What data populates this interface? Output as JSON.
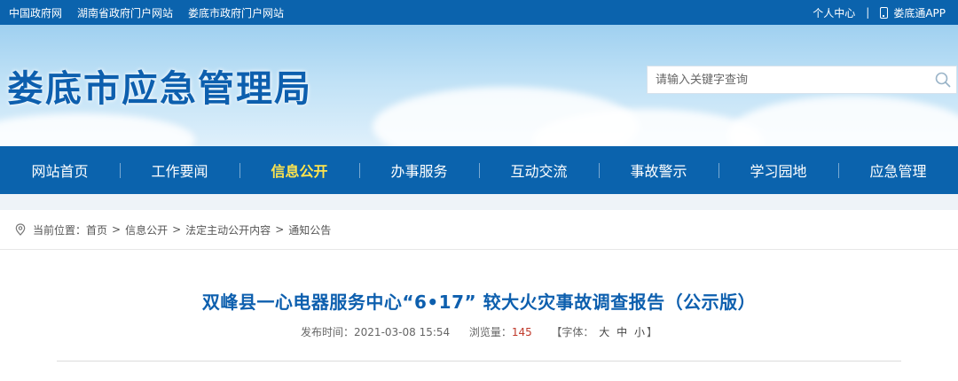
{
  "topbar": {
    "links": [
      "中国政府网",
      "湖南省政府门户网站",
      "娄底市政府门户网站"
    ],
    "personal_center": "个人中心",
    "separator": "|",
    "app_label": "娄底通APP"
  },
  "banner": {
    "site_title": "娄底市应急管理局",
    "search_placeholder": "请输入关键字查询"
  },
  "nav": {
    "items": [
      {
        "label": "网站首页"
      },
      {
        "label": "工作要闻"
      },
      {
        "label": "信息公开",
        "active": true
      },
      {
        "label": "办事服务"
      },
      {
        "label": "互动交流"
      },
      {
        "label": "事故警示"
      },
      {
        "label": "学习园地"
      },
      {
        "label": "应急管理"
      }
    ]
  },
  "breadcrumb": {
    "prefix": "当前位置：",
    "items": [
      "首页",
      "信息公开",
      "法定主动公开内容",
      "通知公告"
    ],
    "arrow": ">"
  },
  "article": {
    "title": "双峰县一心电器服务中心“6•17” 较大火灾事故调查报告（公示版）",
    "publish_label": "发布时间：",
    "publish_time": "2021-03-08 15:54",
    "views_label": "浏览量：",
    "views": "145",
    "font_open": "【字体：",
    "font_large": "大",
    "font_medium": "中",
    "font_small": "小",
    "font_close": "】"
  },
  "colors": {
    "brand_blue": "#0b63ad",
    "title_blue": "#0d5fae",
    "nav_active": "#ffe44d",
    "views_red": "#c0392b"
  }
}
